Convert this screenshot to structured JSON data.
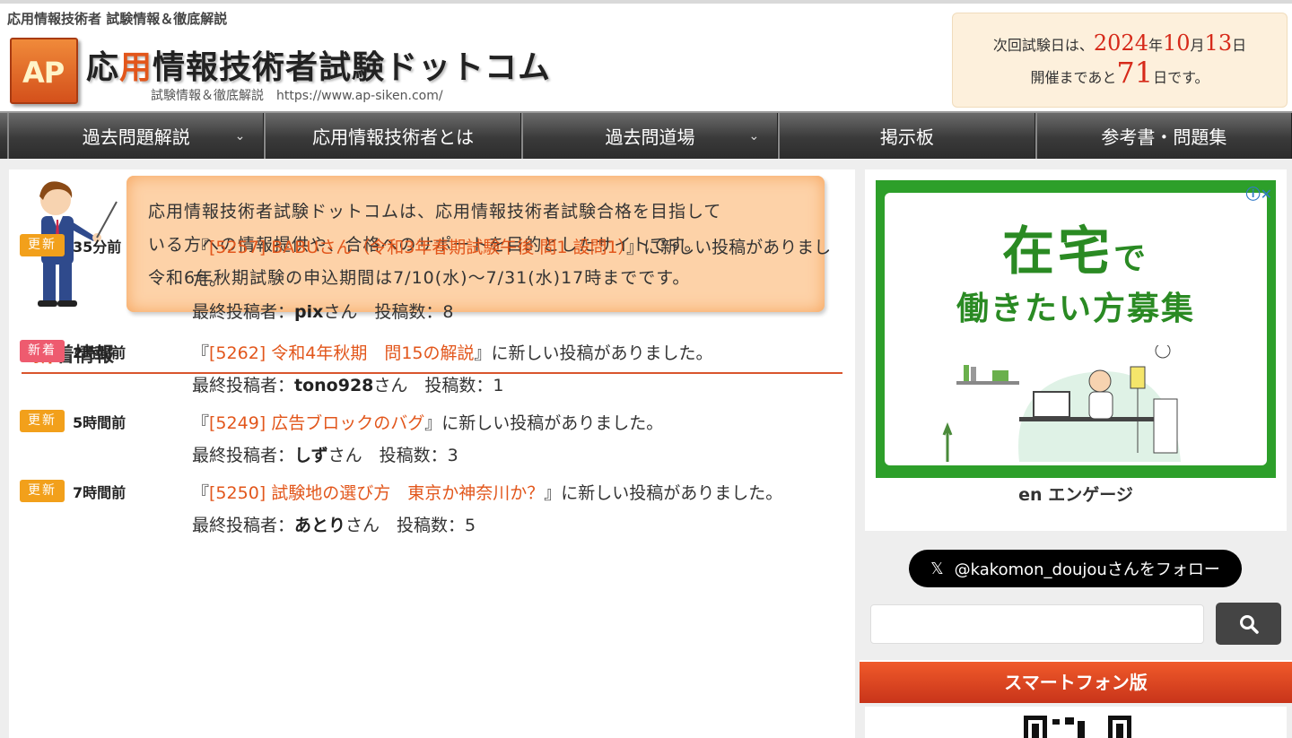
{
  "header": {
    "tagline": "応用情報技術者 試験情報＆徹底解説",
    "logo_text": "AP",
    "title_pre": "応",
    "title_hl": "用",
    "title_post": "情報技術者試験ドットコム",
    "subtitle": "試験情報＆徹底解説　https://www.ap-siken.com/",
    "exam": {
      "line1_pre": "次回試験日は、",
      "year": "2024",
      "year_unit": "年",
      "month": "10",
      "month_unit": "月",
      "day": "13",
      "day_unit": "日",
      "line2_pre": "開催まであと",
      "days_left": "71",
      "line2_post": "日です。"
    }
  },
  "nav": {
    "items": [
      {
        "label": "過去問題解説",
        "dropdown": true
      },
      {
        "label": "応用情報技術者とは",
        "dropdown": false
      },
      {
        "label": "過去問道場",
        "dropdown": true
      },
      {
        "label": "掲示板",
        "dropdown": false
      },
      {
        "label": "参考書・問題集",
        "dropdown": false
      }
    ]
  },
  "intro": {
    "line1": "応用情報技術者試験ドットコムは、応用情報技術者試験合格を目指して",
    "line2": "いる方への情報提供や、合格へのサポートを目的としたサイトです。",
    "line3": "令和6年秋期試験の申込期間は7/10(水)〜7/31(水)17時までです。"
  },
  "news": {
    "heading_first": "新",
    "heading_rest": "着情報",
    "items": [
      {
        "badge": "更新",
        "badge_type": "upd",
        "time": "35分前",
        "pre": "『",
        "link": "[5257] BABUさん（令和3年春期試験午後 問1 設問1）",
        "post": "』に新しい投稿がありました。",
        "author_label": "最終投稿者：",
        "author": "pix",
        "author_suffix": "さん　投稿数：8"
      },
      {
        "badge": "新着",
        "badge_type": "new",
        "time": "2時間前",
        "pre": "『",
        "link": "[5262] 令和4年秋期　問15の解説",
        "post": "』に新しい投稿がありました。",
        "author_label": "最終投稿者：",
        "author": "tono928",
        "author_suffix": "さん　投稿数：1"
      },
      {
        "badge": "更新",
        "badge_type": "upd",
        "time": "5時間前",
        "pre": "『",
        "link": "[5249] 広告ブロックのバグ",
        "post": "』に新しい投稿がありました。",
        "author_label": "最終投稿者：",
        "author": "しず",
        "author_suffix": "さん　投稿数：3"
      },
      {
        "badge": "更新",
        "badge_type": "upd",
        "time": "7時間前",
        "pre": "『",
        "link": "[5250] 試験地の選び方　東京か神奈川か？",
        "post": "』に新しい投稿がありました。",
        "author_label": "最終投稿者：",
        "author": "あとり",
        "author_suffix": "さん　投稿数：5"
      }
    ]
  },
  "ad": {
    "headline_big": "在宅",
    "headline_small": "で",
    "headline2": "働きたい方募集",
    "brand": "en エンゲージ",
    "close": "ⓘ✕"
  },
  "follow": {
    "x_mark": "𝕏",
    "label": "@kakomon_doujouさんをフォロー"
  },
  "search": {
    "placeholder": ""
  },
  "smartphone": {
    "label": "スマートフォン版"
  }
}
